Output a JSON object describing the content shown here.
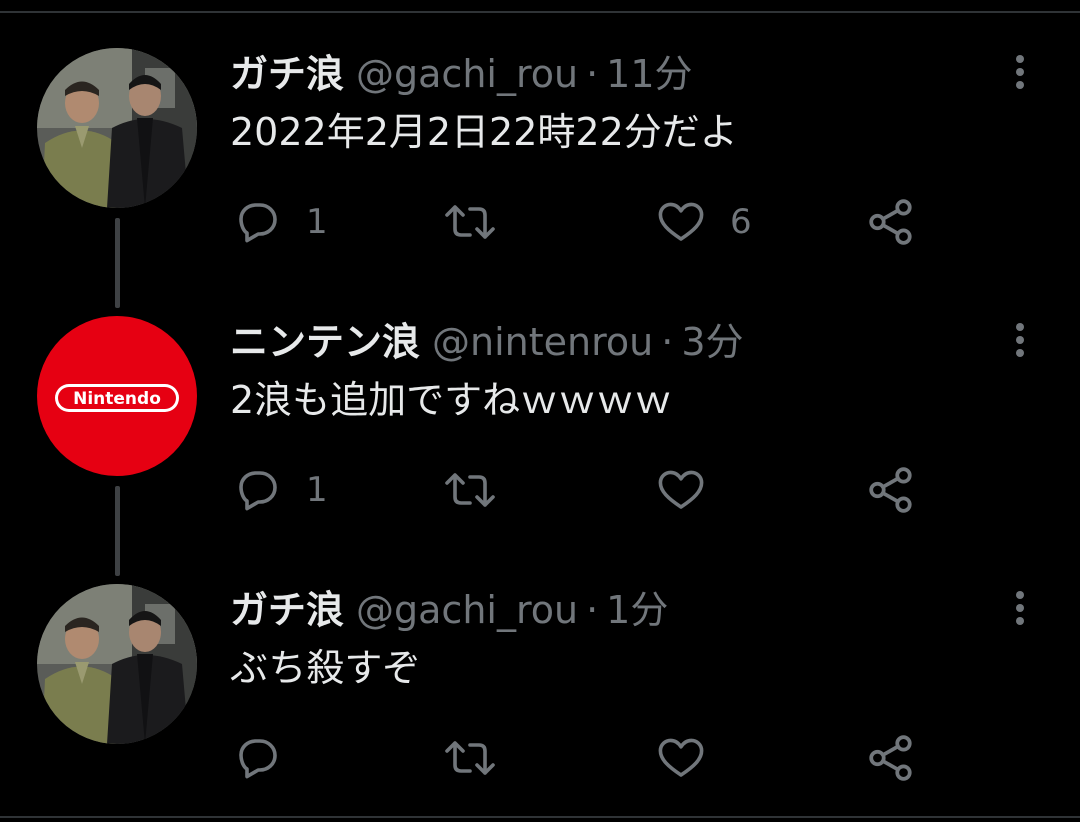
{
  "tweets": [
    {
      "display_name": "ガチ浪",
      "handle": "@gachi_rou",
      "separator": "·",
      "timestamp": "11分",
      "text": "2022年2月2日22時22分だよ",
      "avatar": "photo-avatar",
      "actions": {
        "reply_count": "1",
        "retweet_count": "",
        "like_count": "6"
      }
    },
    {
      "display_name": "ニンテン浪",
      "handle": "@nintenrou",
      "separator": "·",
      "timestamp": "3分",
      "text": "2浪も追加ですねｗｗｗｗ",
      "avatar": "nintendo-logo-avatar",
      "avatar_logo_text": "Nintendo",
      "actions": {
        "reply_count": "1",
        "retweet_count": "",
        "like_count": ""
      }
    },
    {
      "display_name": "ガチ浪",
      "handle": "@gachi_rou",
      "separator": "·",
      "timestamp": "1分",
      "text": "ぶち殺すぞ",
      "avatar": "photo-avatar",
      "actions": {
        "reply_count": "",
        "retweet_count": "",
        "like_count": ""
      }
    }
  ],
  "icons": {
    "reply": "reply-icon",
    "retweet": "retweet-icon",
    "like": "heart-icon",
    "share": "share-icon",
    "more": "more-vertical-icon"
  },
  "colors": {
    "background": "#000000",
    "text_primary": "#e7e9ea",
    "text_secondary": "#71767b",
    "thread_line": "#3e4144",
    "nintendo_red": "#e60012"
  }
}
